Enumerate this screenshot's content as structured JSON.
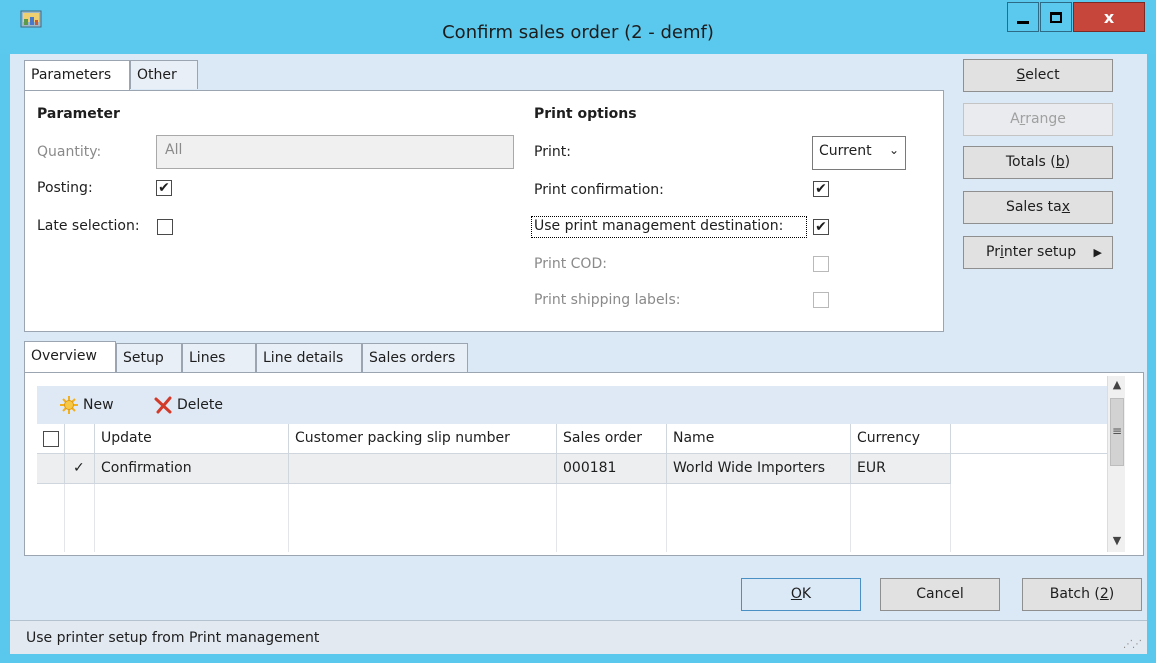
{
  "window": {
    "title": "Confirm sales order (2 - demf)",
    "close_glyph": "x"
  },
  "top_tabs": [
    "Parameters",
    "Other"
  ],
  "parameter": {
    "heading": "Parameter",
    "quantity_label": "Quantity:",
    "quantity_value": "All",
    "posting_label": "Posting:",
    "posting_checked": true,
    "late_selection_label": "Late selection:",
    "late_selection_checked": false
  },
  "print_options": {
    "heading": "Print options",
    "print_label": "Print:",
    "print_value": "Current",
    "print_confirmation_label": "Print confirmation:",
    "print_confirmation_checked": true,
    "use_print_mgmt_label": "Use print management destination:",
    "use_print_mgmt_checked": true,
    "print_cod_label": "Print COD:",
    "print_cod_checked": false,
    "print_shipping_labels_label": "Print shipping labels:",
    "print_shipping_labels_checked": false
  },
  "side_buttons": {
    "select": {
      "pre": "",
      "key": "S",
      "post": "elect"
    },
    "arrange": {
      "pre": "A",
      "key": "r",
      "post": "range"
    },
    "totals": {
      "pre": "Totals (",
      "key": "b",
      "post": ")"
    },
    "sales_tax": {
      "pre": "Sales ta",
      "key": "x",
      "post": ""
    },
    "printer_setup": {
      "pre": "Pr",
      "key": "i",
      "post": "nter setup"
    }
  },
  "bottom_tabs": [
    "Overview",
    "Setup",
    "Lines",
    "Line details",
    "Sales orders"
  ],
  "grid_toolbar": {
    "new_label": "New",
    "delete_label": "Delete"
  },
  "grid": {
    "columns": [
      "Update",
      "Customer packing slip number",
      "Sales order",
      "Name",
      "Currency"
    ],
    "rows": [
      {
        "marked": "✓",
        "update": "Confirmation",
        "packing_slip": "",
        "sales_order": "000181",
        "name": "World Wide Importers",
        "currency": "EUR"
      }
    ]
  },
  "footer_buttons": {
    "ok": {
      "pre": "",
      "key": "O",
      "post": "K"
    },
    "cancel": "Cancel",
    "batch": {
      "pre": "Batch (",
      "key": "2",
      "post": ")"
    }
  },
  "status": "Use printer setup from Print management",
  "colors": {
    "titlebar": "#5bc9ee",
    "client_bg": "#dbe8f6",
    "close_button": "#c7463c",
    "new_icon": "#f2b01e",
    "delete_icon": "#d23a2a"
  }
}
